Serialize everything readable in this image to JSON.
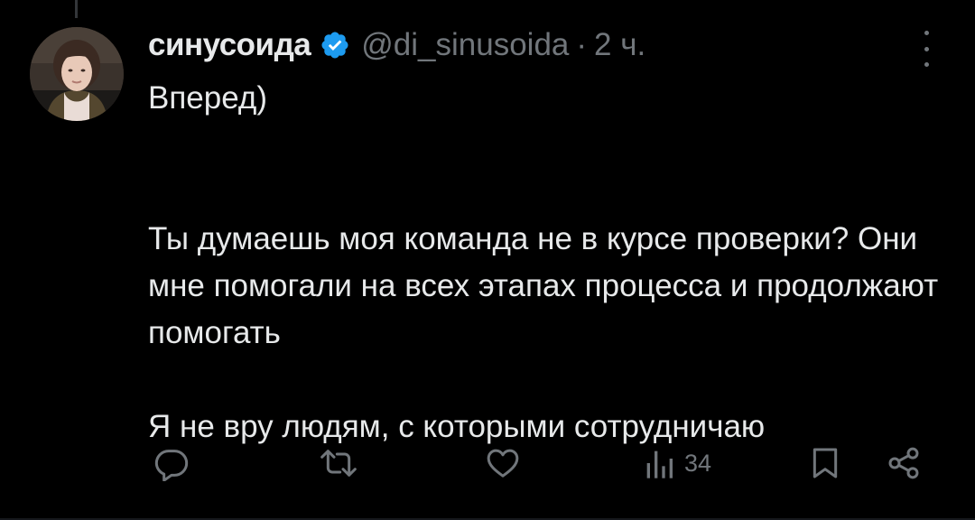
{
  "tweet": {
    "author_name": "синусоида",
    "handle": "@di_sinusoida",
    "separator": "·",
    "time": "2 ч.",
    "verified": true,
    "paragraphs": [
      "Вперед)",
      "Ты думаешь моя команда не в курсе проверки? Они мне помогали на всех этапах процесса и продолжают помогать",
      "Я не вру людям, с которыми сотрудничаю"
    ]
  },
  "actions": {
    "reply_icon": "reply-icon",
    "retweet_icon": "retweet-icon",
    "like_icon": "heart-icon",
    "views_icon": "views-icon",
    "views_count": "34",
    "bookmark_icon": "bookmark-icon",
    "share_icon": "share-icon"
  },
  "colors": {
    "background": "#000000",
    "text": "#e7e9ea",
    "muted": "#71767b",
    "verified": "#1d9bf0"
  }
}
